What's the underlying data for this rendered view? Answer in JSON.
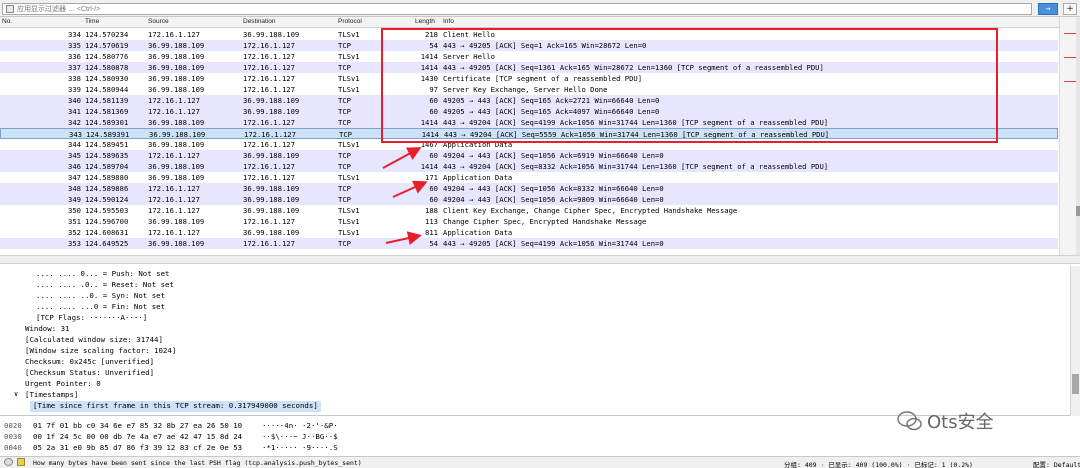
{
  "filter": {
    "placeholder": "应用显示过滤器 … <Ctrl-/>",
    "apply_label": "→",
    "add_label": "+"
  },
  "columns": [
    "No.",
    "Time",
    "Source",
    "Destination",
    "Protocol",
    "Length",
    "Info"
  ],
  "packets": [
    {
      "no": "334",
      "time": "124.570234",
      "src": "172.16.1.127",
      "dst": "36.99.188.109",
      "proto": "TLSv1",
      "len": "218",
      "info": "Client Hello"
    },
    {
      "no": "335",
      "time": "124.570619",
      "src": "36.99.188.109",
      "dst": "172.16.1.127",
      "proto": "TCP",
      "len": "54",
      "info": "443 → 49205 [ACK] Seq=1 Ack=165 Win=28672 Len=0"
    },
    {
      "no": "336",
      "time": "124.580776",
      "src": "36.99.188.109",
      "dst": "172.16.1.127",
      "proto": "TLSv1",
      "len": "1414",
      "info": "Server Hello"
    },
    {
      "no": "337",
      "time": "124.580878",
      "src": "36.99.188.109",
      "dst": "172.16.1.127",
      "proto": "TCP",
      "len": "1414",
      "info": "443 → 49205 [ACK] Seq=1361 Ack=165 Win=28672 Len=1360 [TCP segment of a reassembled PDU]"
    },
    {
      "no": "338",
      "time": "124.580930",
      "src": "36.99.188.109",
      "dst": "172.16.1.127",
      "proto": "TLSv1",
      "len": "1430",
      "info": "Certificate [TCP segment of a reassembled PDU]"
    },
    {
      "no": "339",
      "time": "124.580944",
      "src": "36.99.188.109",
      "dst": "172.16.1.127",
      "proto": "TLSv1",
      "len": "97",
      "info": "Server Key Exchange, Server Hello Done"
    },
    {
      "no": "340",
      "time": "124.581139",
      "src": "172.16.1.127",
      "dst": "36.99.188.109",
      "proto": "TCP",
      "len": "60",
      "info": "49205 → 443 [ACK] Seq=165 Ack=2721 Win=66640 Len=0"
    },
    {
      "no": "341",
      "time": "124.581369",
      "src": "172.16.1.127",
      "dst": "36.99.188.109",
      "proto": "TCP",
      "len": "60",
      "info": "49205 → 443 [ACK] Seq=165 Ack=4097 Win=66640 Len=0"
    },
    {
      "no": "342",
      "time": "124.589301",
      "src": "36.99.188.109",
      "dst": "172.16.1.127",
      "proto": "TCP",
      "len": "1414",
      "info": "443 → 49204 [ACK] Seq=4199 Ack=1056 Win=31744 Len=1360 [TCP segment of a reassembled PDU]"
    },
    {
      "no": "343",
      "time": "124.589391",
      "src": "36.99.188.109",
      "dst": "172.16.1.127",
      "proto": "TCP",
      "len": "1414",
      "info": "443 → 49204 [ACK] Seq=5559 Ack=1056 Win=31744 Len=1360 [TCP segment of a reassembled PDU]"
    },
    {
      "no": "344",
      "time": "124.589451",
      "src": "36.99.188.109",
      "dst": "172.16.1.127",
      "proto": "TLSv1",
      "len": "1467",
      "info": "Application Data"
    },
    {
      "no": "345",
      "time": "124.589635",
      "src": "172.16.1.127",
      "dst": "36.99.188.109",
      "proto": "TCP",
      "len": "60",
      "info": "49204 → 443 [ACK] Seq=1056 Ack=6919 Win=66640 Len=0"
    },
    {
      "no": "346",
      "time": "124.589704",
      "src": "36.99.188.109",
      "dst": "172.16.1.127",
      "proto": "TCP",
      "len": "1414",
      "info": "443 → 49204 [ACK] Seq=8332 Ack=1056 Win=31744 Len=1360 [TCP segment of a reassembled PDU]"
    },
    {
      "no": "347",
      "time": "124.589880",
      "src": "36.99.188.109",
      "dst": "172.16.1.127",
      "proto": "TLSv1",
      "len": "171",
      "info": "Application Data"
    },
    {
      "no": "348",
      "time": "124.589886",
      "src": "172.16.1.127",
      "dst": "36.99.188.109",
      "proto": "TCP",
      "len": "60",
      "info": "49204 → 443 [ACK] Seq=1056 Ack=8332 Win=66640 Len=0"
    },
    {
      "no": "349",
      "time": "124.590124",
      "src": "172.16.1.127",
      "dst": "36.99.188.109",
      "proto": "TCP",
      "len": "60",
      "info": "49204 → 443 [ACK] Seq=1056 Ack=9809 Win=66640 Len=0"
    },
    {
      "no": "350",
      "time": "124.595503",
      "src": "172.16.1.127",
      "dst": "36.99.188.109",
      "proto": "TLSv1",
      "len": "188",
      "info": "Client Key Exchange, Change Cipher Spec, Encrypted Handshake Message"
    },
    {
      "no": "351",
      "time": "124.596700",
      "src": "36.99.188.109",
      "dst": "172.16.1.127",
      "proto": "TLSv1",
      "len": "113",
      "info": "Change Cipher Spec, Encrypted Handshake Message"
    },
    {
      "no": "352",
      "time": "124.608631",
      "src": "172.16.1.127",
      "dst": "36.99.188.109",
      "proto": "TLSv1",
      "len": "811",
      "info": "Application Data"
    },
    {
      "no": "353",
      "time": "124.649525",
      "src": "36.99.188.109",
      "dst": "172.16.1.127",
      "proto": "TCP",
      "len": "54",
      "info": "443 → 49205 [ACK] Seq=4199 Ack=1056 Win=31744 Len=0"
    }
  ],
  "details": [
    ".... .... 0... = Push: Not set",
    ".... .... .0.. = Reset: Not set",
    ".... .... ..0. = Syn: Not set",
    ".... .... ...0 = Fin: Not set",
    "[TCP Flags: ·······A····]",
    "Window: 31",
    "[Calculated window size: 31744]",
    "[Window size scaling factor: 1024]",
    "Checksum: 0x245c [unverified]",
    "[Checksum Status: Unverified]",
    "Urgent Pointer: 0",
    "[Timestamps]",
    "[Time since first frame in this TCP stream: 0.317949000 seconds]"
  ],
  "bytes": [
    {
      "offset": "0020",
      "hex": "01 7f 01 bb c0 34 6e e7  85 32 8b 27 ea 26 50 10",
      "ascii": "·····4n· ·2·'·&P·"
    },
    {
      "offset": "0030",
      "hex": "00 1f 24 5c 00 00 db 7e  4a e7 ae 42 47 15 8d 24",
      "ascii": "··$\\···~ J··BG··$"
    },
    {
      "offset": "0040",
      "hex": "05 2a 31 e0 9b 85 d7 86  f3 39 12 83 cf 2e 0e 53",
      "ascii": "·*1····· ·9····.S"
    }
  ],
  "watermark": "Ots安全",
  "status": {
    "hint": "How many bytes have been sent since the last PSH flag (tcp.analysis.push_bytes_sent)",
    "groups": "分组: 409 · 已显示: 409 (100.0%) · 已标记: 1 (0.2%)",
    "profile": "配置: Default"
  },
  "colors": {
    "selected_row": "#cde2f7",
    "annotation_red": "#e81e2a",
    "tcp_row": "#e7e6ff"
  }
}
